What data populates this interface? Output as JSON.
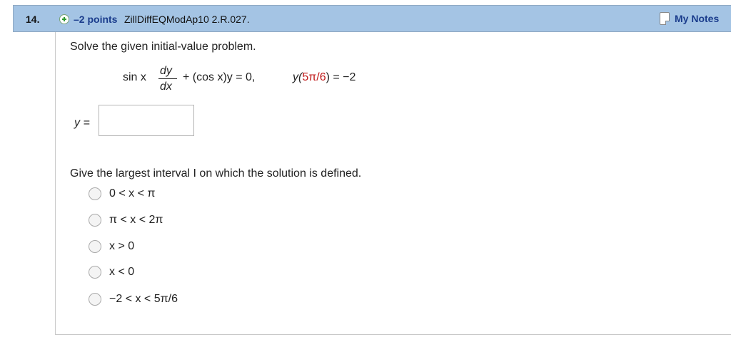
{
  "header": {
    "question_number": "14.",
    "points": "–2 points",
    "source": "ZillDiffEQModAp10 2.R.027.",
    "my_notes_label": "My Notes"
  },
  "question": {
    "prompt": "Solve the given initial-value problem.",
    "equation": {
      "lhs_prefix": "sin x",
      "dy": "dy",
      "dx": "dx",
      "middle": "+ (cos x)y = 0,",
      "ic_start": "y(",
      "ic_value": "5π/6",
      "ic_end": ") = −2"
    },
    "answer_label": "y =",
    "answer_value": "",
    "interval_prompt": "Give the largest interval I on which the solution is defined.",
    "options": [
      {
        "label": "0 < x < π",
        "selected": false
      },
      {
        "label": "π < x < 2π",
        "selected": false
      },
      {
        "label": "x > 0",
        "selected": false
      },
      {
        "label": "x < 0",
        "selected": false
      },
      {
        "label": "−2 < x < 5π/6",
        "selected": false
      }
    ]
  },
  "colors": {
    "header_bg": "#a4c4e4",
    "link_blue": "#1a3c8c",
    "highlight_red": "#c01818",
    "plus_green": "#2f9a2f"
  },
  "icons": {
    "add": "plus-circle-icon",
    "notes": "notes-page-icon"
  }
}
